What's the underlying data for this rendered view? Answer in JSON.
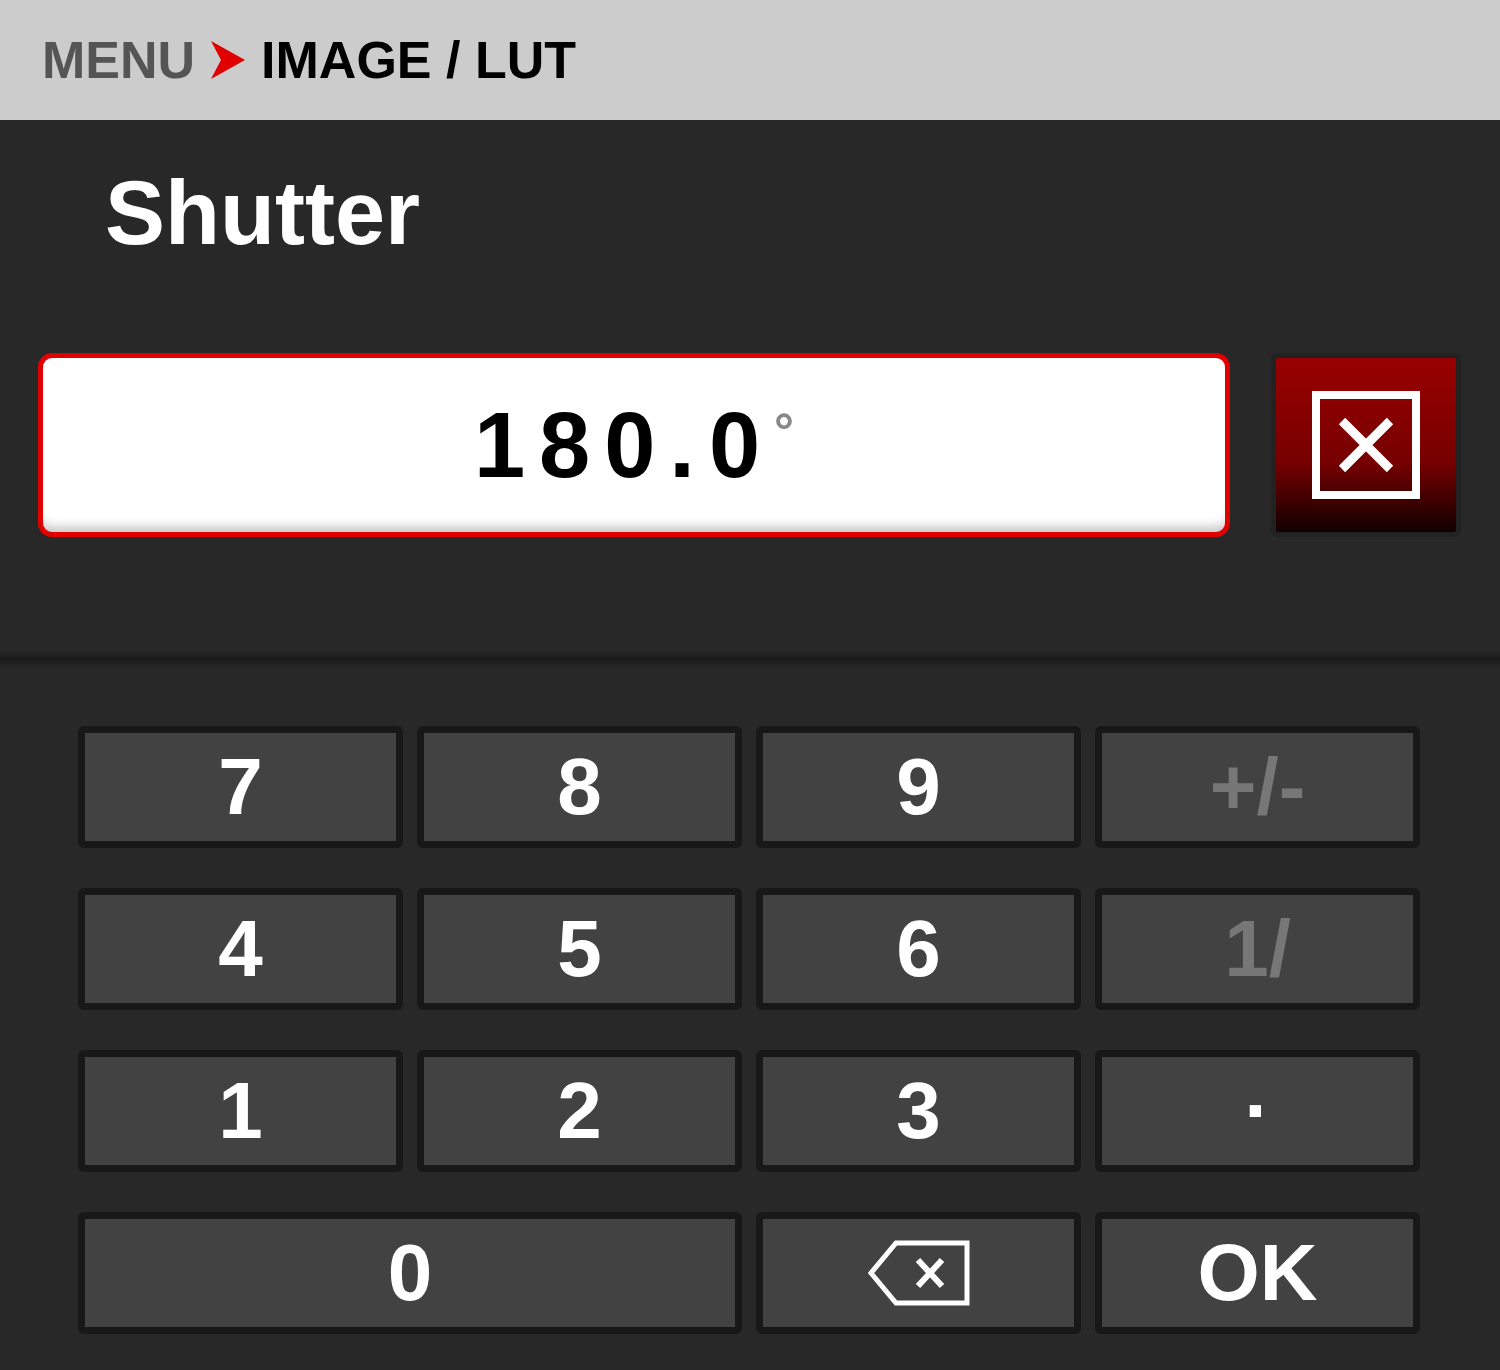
{
  "breadcrumb": {
    "root": "MENU",
    "current": "IMAGE / LUT"
  },
  "title": "Shutter",
  "field": {
    "value": "180.0",
    "unit": "°",
    "focused": true
  },
  "keypad": [
    {
      "kind": "text",
      "label": "7",
      "disabled": false
    },
    {
      "kind": "text",
      "label": "8",
      "disabled": false
    },
    {
      "kind": "text",
      "label": "9",
      "disabled": false
    },
    {
      "kind": "text",
      "label": "+/-",
      "disabled": true
    },
    {
      "kind": "text",
      "label": "4",
      "disabled": false
    },
    {
      "kind": "text",
      "label": "5",
      "disabled": false
    },
    {
      "kind": "text",
      "label": "6",
      "disabled": false
    },
    {
      "kind": "text",
      "label": "1/",
      "disabled": true
    },
    {
      "kind": "text",
      "label": "1",
      "disabled": false
    },
    {
      "kind": "text",
      "label": "2",
      "disabled": false
    },
    {
      "kind": "text",
      "label": "3",
      "disabled": false
    },
    {
      "kind": "text",
      "label": "·",
      "disabled": false
    },
    {
      "kind": "wide",
      "label": "0",
      "disabled": false
    },
    {
      "kind": "backspace",
      "disabled": false
    },
    {
      "kind": "text",
      "label": "OK",
      "disabled": false
    }
  ]
}
